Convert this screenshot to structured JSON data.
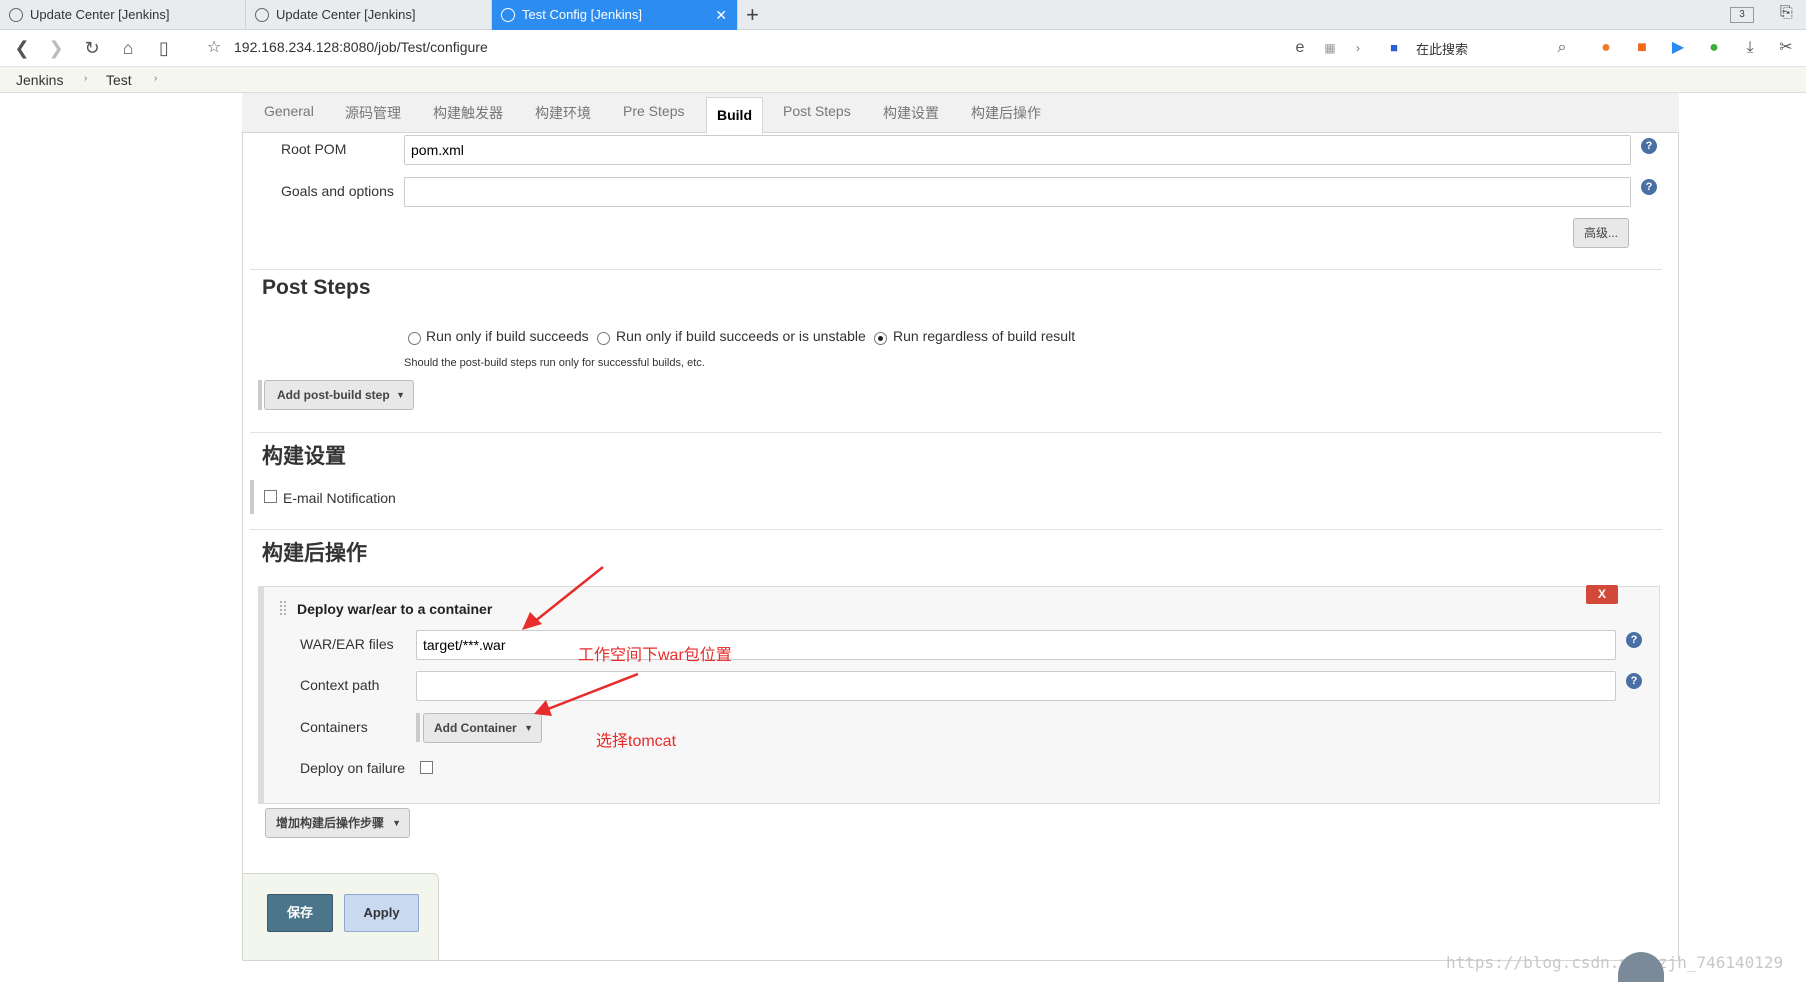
{
  "browser": {
    "tabs": [
      {
        "label": "Update Center [Jenkins]"
      },
      {
        "label": "Update Center [Jenkins]"
      },
      {
        "label": "Test Config [Jenkins]"
      }
    ],
    "tab_count": "3",
    "address": "192.168.234.128:8080/job/Test/configure",
    "search_placeholder": "在此搜索"
  },
  "breadcrumb": {
    "items": [
      "Jenkins",
      "Test"
    ]
  },
  "config_tabs": [
    "General",
    "源码管理",
    "构建触发器",
    "构建环境",
    "Pre Steps",
    "Build",
    "Post Steps",
    "构建设置",
    "构建后操作"
  ],
  "build": {
    "root_pom_label": "Root POM",
    "root_pom_value": "pom.xml",
    "goals_label": "Goals and options",
    "goals_value": "",
    "advanced_label": "高级..."
  },
  "post_steps": {
    "title": "Post Steps",
    "options": [
      "Run only if build succeeds",
      "Run only if build succeeds or is unstable",
      "Run regardless of build result"
    ],
    "selected_index": 2,
    "note": "Should the post-build steps run only for successful builds, etc.",
    "add_button": "Add post-build step"
  },
  "build_settings": {
    "title": "构建设置",
    "email_label": "E-mail Notification"
  },
  "post_build": {
    "title": "构建后操作",
    "deploy_title": "Deploy war/ear to a container",
    "delete_label": "X",
    "war_label": "WAR/EAR files",
    "war_value": "target/***.war",
    "context_label": "Context path",
    "context_value": "",
    "containers_label": "Containers",
    "add_container": "Add Container",
    "deploy_failure_label": "Deploy on failure",
    "add_step": "增加构建后操作步骤"
  },
  "footer": {
    "save": "保存",
    "apply": "Apply"
  },
  "annotations": {
    "war_note": "工作空间下war包位置",
    "container_note": "选择tomcat"
  },
  "watermark": "https://blog.csdn.net/zjh_746140129",
  "colors": {
    "active_tab": "#2c8cf0",
    "save_button": "#4b758b",
    "apply_button": "#c9daf0",
    "annotation": "#e82b2b",
    "delete_button": "#d24939"
  }
}
